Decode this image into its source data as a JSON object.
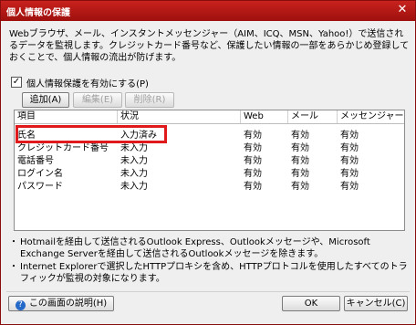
{
  "window": {
    "title": "個人情報の保護"
  },
  "description": "Webブラウザ、メール、インスタントメッセンジャー（AIM、ICQ、MSN、Yahoo!）で送信されるデータを監視します。クレジットカード番号など、保護したい情報の一部をあらかじめ登録しておくことで、個人情報の流出が防げます。",
  "enable_checkbox": {
    "label": "個人情報保護を有効にする(P)",
    "checked": true
  },
  "toolbar": {
    "add": "追加(A)",
    "edit": "編集(E)",
    "delete": "削除(R)"
  },
  "table": {
    "headers": [
      "項目",
      "状況",
      "Web",
      "メール",
      "メッセンジャー"
    ],
    "rows": [
      [
        "氏名",
        "入力済み",
        "有効",
        "有効",
        "有効"
      ],
      [
        "クレジットカード番号",
        "未入力",
        "有効",
        "有効",
        "有効"
      ],
      [
        "電話番号",
        "未入力",
        "有効",
        "有効",
        "有効"
      ],
      [
        "ログイン名",
        "未入力",
        "有効",
        "有効",
        "有効"
      ],
      [
        "パスワード",
        "未入力",
        "有効",
        "有効",
        "有効"
      ]
    ]
  },
  "notes": [
    "Hotmailを経由して送信されるOutlook Express、Outlookメッセージや、Microsoft Exchange Serverを経由して送信されるOutlookメッセージを除きます。",
    "Internet Explorerで選択したHTTPプロキシを含め、HTTPプロトコルを使用したすべてのトラフィックが監視の対象になります。"
  ],
  "footer": {
    "help": "この画面の説明(H)",
    "ok": "OK",
    "cancel": "キャンセル(C)"
  },
  "colors": {
    "titlebar": "#b5150f",
    "highlight": "#e0191d"
  }
}
